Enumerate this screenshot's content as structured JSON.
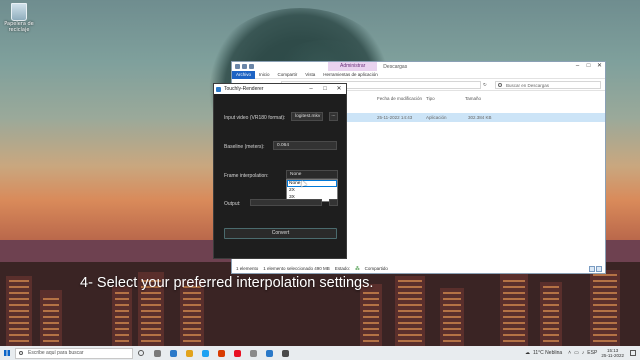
{
  "desktop": {
    "recycle_bin_label": "Papelera de reciclaje"
  },
  "explorer": {
    "context_tab": "Administrar",
    "title": "Descargas",
    "ribbon_tabs": [
      "Archivo",
      "Inicio",
      "Compartir",
      "Vista",
      "Herramientas de aplicación"
    ],
    "search_placeholder": "Buscar en Descargas",
    "columns": [
      "Fecha de modificación",
      "Tipo",
      "Tamaño"
    ],
    "row": {
      "date": "25-11-2022 14:43",
      "type": "Aplicación",
      "size": "302.384 KB"
    },
    "status": {
      "items": "1 elemento",
      "selected": "1 elemento seleccionado 490 MB",
      "state_label": "Estado:",
      "state_value": "Compartido"
    }
  },
  "app": {
    "title": "Touchly-Renderer",
    "input_video_label": "Input video (VR180 format):",
    "input_video_value": "logitest.mkv",
    "browse_label": "...",
    "baseline_label": "Baseline (meters):",
    "baseline_value": "0.064",
    "interp_label": "Frame interpolation:",
    "interp_value": "None",
    "interp_options": [
      "None",
      "2X",
      "3X"
    ],
    "output_label": "Output:",
    "convert_label": "Convert"
  },
  "caption": "4- Select your preferred interpolation settings.",
  "taskbar": {
    "search_placeholder": "Escribe aquí para buscar",
    "weather": "11°C  Neblina",
    "language": "ESP",
    "time": "15:13",
    "date": "25-11-2022",
    "app_colors": [
      "#7a7a7a",
      "#2b79c8",
      "#e2a31b",
      "#1da1f2",
      "#d83b01",
      "#e81123",
      "#8a8a8a",
      "#2b79c8",
      "#4a4a4a"
    ]
  }
}
